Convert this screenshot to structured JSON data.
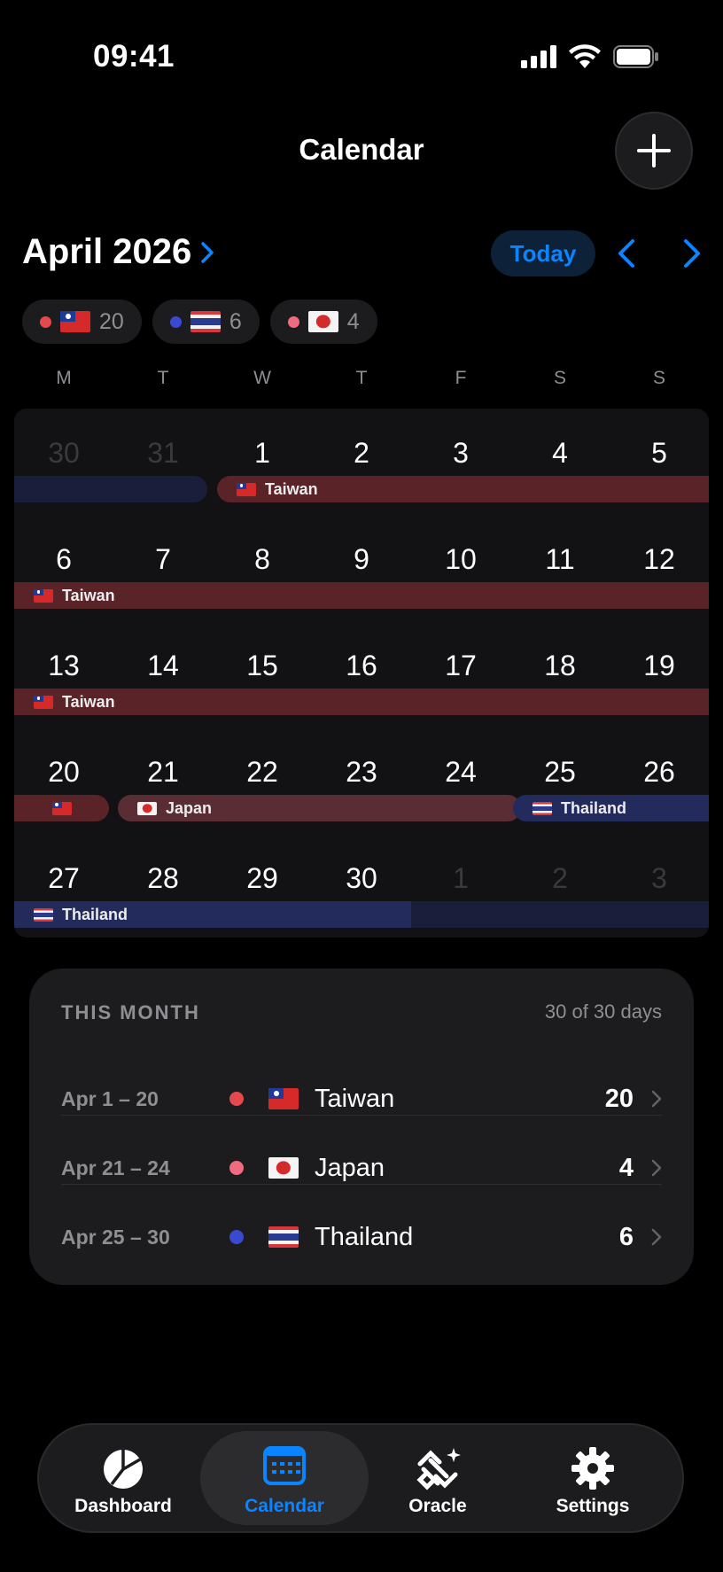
{
  "status_bar": {
    "time": "09:41"
  },
  "header": {
    "title": "Calendar",
    "add_icon": "plus-icon"
  },
  "month_nav": {
    "month_label": "April 2026",
    "today_label": "Today"
  },
  "summary_chips": [
    {
      "country": "Taiwan",
      "count": "20",
      "dot_color": "#e5484d"
    },
    {
      "country": "Thailand",
      "count": "6",
      "dot_color": "#3a49d1"
    },
    {
      "country": "Japan",
      "count": "4",
      "dot_color": "#f06b80"
    }
  ],
  "weekdays": [
    "M",
    "T",
    "W",
    "T",
    "F",
    "S",
    "S"
  ],
  "calendar": {
    "weeks": [
      [
        "30",
        "31",
        "1",
        "2",
        "3",
        "4",
        "5"
      ],
      [
        "6",
        "7",
        "8",
        "9",
        "10",
        "11",
        "12"
      ],
      [
        "13",
        "14",
        "15",
        "16",
        "17",
        "18",
        "19"
      ],
      [
        "20",
        "21",
        "22",
        "23",
        "24",
        "25",
        "26"
      ],
      [
        "27",
        "28",
        "29",
        "30",
        "1",
        "2",
        "3"
      ]
    ],
    "trip_labels": {
      "taiwan": "Taiwan",
      "japan": "Japan",
      "thailand": "Thailand"
    }
  },
  "this_month": {
    "title": "THIS MONTH",
    "days_summary": "30 of 30 days",
    "trips": [
      {
        "range": "Apr 1 – 20",
        "country": "Taiwan",
        "days": "20",
        "dot_color": "#e5484d"
      },
      {
        "range": "Apr 21 – 24",
        "country": "Japan",
        "days": "4",
        "dot_color": "#f06b80"
      },
      {
        "range": "Apr 25 – 30",
        "country": "Thailand",
        "days": "6",
        "dot_color": "#3a49d1"
      }
    ]
  },
  "tab_bar": {
    "dashboard": "Dashboard",
    "calendar": "Calendar",
    "oracle": "Oracle",
    "settings": "Settings",
    "active_color": "#0a84ff"
  }
}
